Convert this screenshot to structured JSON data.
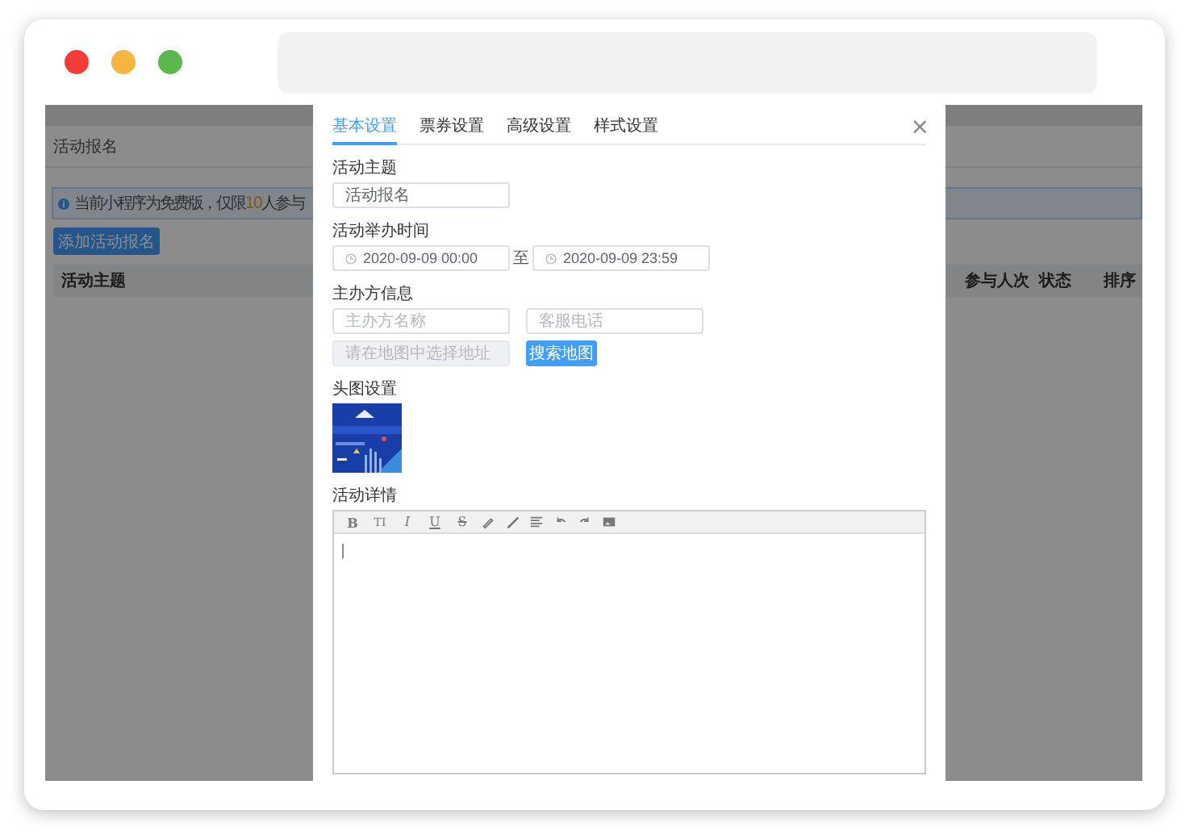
{
  "background_page": {
    "title": "活动报名",
    "notice": {
      "before": "当前小程序为免费版，仅限",
      "highlight": "10",
      "after": "人参与"
    },
    "add_button": "添加活动报名",
    "table_columns": [
      "活动主题",
      "参与人次",
      "状态",
      "排序"
    ]
  },
  "dialog": {
    "tabs": [
      {
        "label": "基本设置",
        "selected": true
      },
      {
        "label": "票券设置",
        "selected": false
      },
      {
        "label": "高级设置",
        "selected": false
      },
      {
        "label": "样式设置",
        "selected": false
      }
    ],
    "close": "×",
    "theme": {
      "label": "活动主题",
      "value": "活动报名"
    },
    "time": {
      "label": "活动举办时间",
      "start": "2020-09-09 00:00",
      "separator": "至",
      "end": "2020-09-09 23:59"
    },
    "organizer": {
      "label": "主办方信息",
      "name_placeholder": "主办方名称",
      "phone_placeholder": "客服电话",
      "address_placeholder": "请在地图中选择地址",
      "address_disabled": true,
      "map_button": "搜索地图"
    },
    "cover": {
      "label": "头图设置"
    },
    "details": {
      "label": "活动详情",
      "toolbar": [
        {
          "kind": "bold",
          "label": "B"
        },
        {
          "kind": "size",
          "label": "TI"
        },
        {
          "kind": "italic",
          "label": "I"
        },
        {
          "kind": "underline",
          "label": "U"
        },
        {
          "kind": "strike",
          "label": "S"
        }
      ]
    }
  }
}
